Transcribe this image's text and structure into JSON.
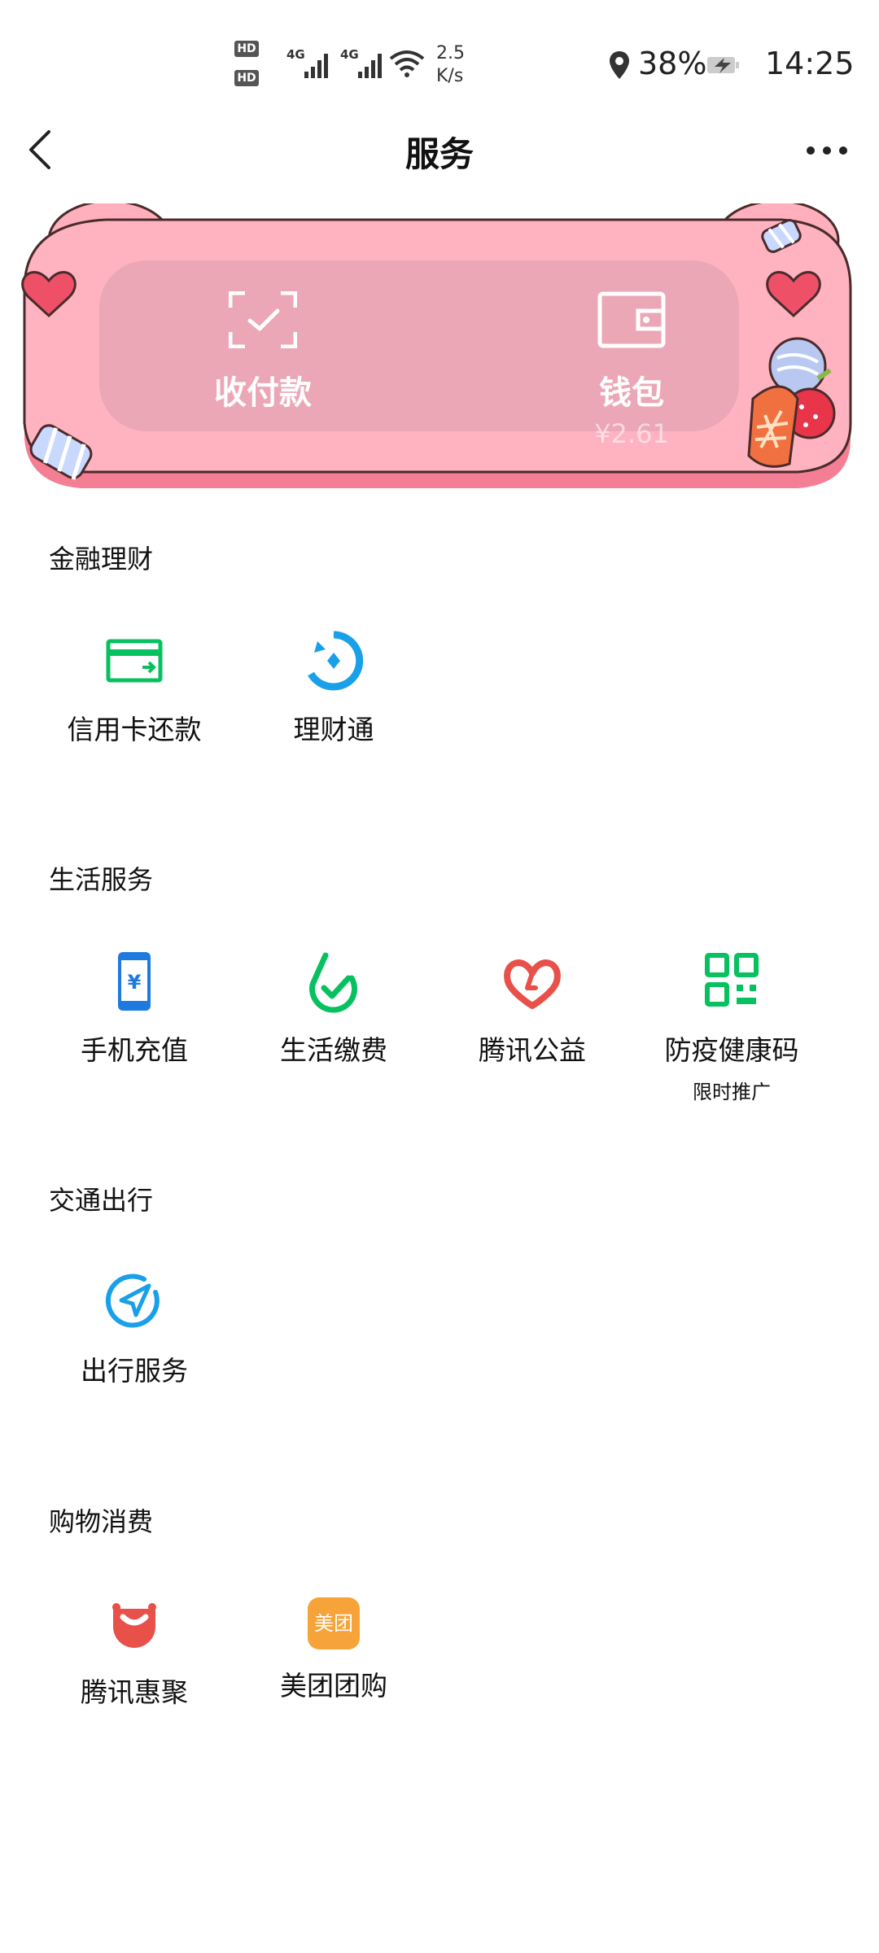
{
  "status_bar": {
    "hd1": "HD",
    "hd2": "HD",
    "signal1_label": "4G",
    "signal2_label": "4G",
    "net_speed_value": "2.5",
    "net_speed_unit": "K/s",
    "battery": "38%",
    "time": "14:25"
  },
  "header": {
    "title": "服务"
  },
  "banner": {
    "pay_label": "收付款",
    "wallet_label": "钱包",
    "wallet_balance": "¥2.61",
    "panel_color": "#e8a4b4",
    "bear_color": "#ffb0bc"
  },
  "sections": [
    {
      "title": "金融理财",
      "items": [
        {
          "label": "信用卡还款",
          "icon": "credit-card-icon"
        },
        {
          "label": "理财通",
          "icon": "wealth-icon"
        }
      ]
    },
    {
      "title": "生活服务",
      "items": [
        {
          "label": "手机充值",
          "icon": "phone-recharge-icon"
        },
        {
          "label": "生活缴费",
          "icon": "utility-payment-icon"
        },
        {
          "label": "腾讯公益",
          "icon": "charity-heart-icon"
        },
        {
          "label": "防疫健康码",
          "icon": "health-code-icon",
          "sub": "限时推广"
        }
      ]
    },
    {
      "title": "交通出行",
      "items": [
        {
          "label": "出行服务",
          "icon": "travel-navigation-icon"
        }
      ]
    },
    {
      "title": "购物消费",
      "items": [
        {
          "label": "腾讯惠聚",
          "icon": "shopping-bag-icon"
        },
        {
          "label": "美团团购",
          "icon": "meituan-icon",
          "icon_text": "美团"
        }
      ]
    }
  ],
  "colors": {
    "green": "#07c160",
    "blue": "#1aa0e8",
    "phone_blue": "#1f7ae0",
    "red": "#e8504a",
    "meituan_orange": "#f6a43a"
  }
}
